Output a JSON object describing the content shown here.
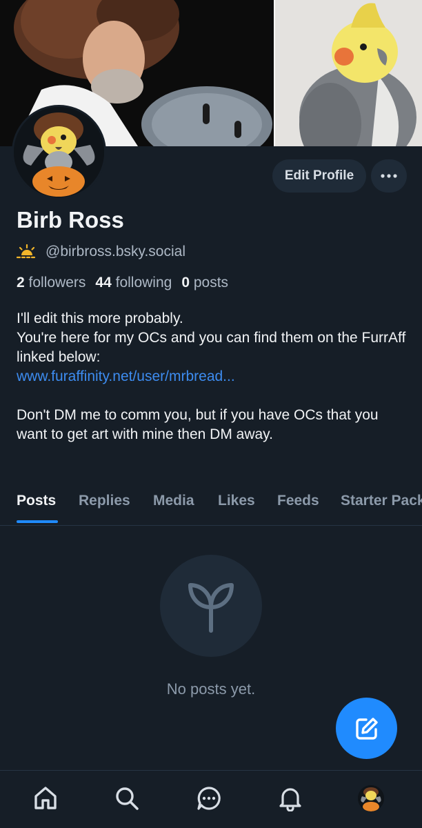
{
  "profile": {
    "display_name": "Birb Ross",
    "handle": "@birbross.bsky.social",
    "handle_icon": "sunrise-icon",
    "edit_label": "Edit Profile",
    "more_label": "···",
    "stats": {
      "followers_count": "2",
      "followers_label": "followers",
      "following_count": "44",
      "following_label": "following",
      "posts_count": "0",
      "posts_label": "posts"
    },
    "bio": {
      "line1": "I'll edit this more probably.",
      "line2": "You're here for my OCs and you can find them on the FurrAff linked below:",
      "link": "www.furaffinity.net/user/mrbread...",
      "line3": "Don't DM me to comm you, but if you have OCs that you want to get art with mine then DM away."
    }
  },
  "tabs": [
    {
      "label": "Posts",
      "active": true
    },
    {
      "label": "Replies"
    },
    {
      "label": "Media"
    },
    {
      "label": "Likes"
    },
    {
      "label": "Feeds"
    },
    {
      "label": "Starter Packs"
    }
  ],
  "empty_state": {
    "icon": "sprout-icon",
    "text": "No posts yet."
  },
  "fab": {
    "icon": "compose-icon"
  },
  "bottom_nav": [
    "home-icon",
    "search-icon",
    "chat-icon",
    "bell-icon",
    "profile-avatar"
  ],
  "colors": {
    "background": "#161e27",
    "accent": "#208bfe",
    "link": "#3d8cf0",
    "muted": "#8c9aaa"
  }
}
